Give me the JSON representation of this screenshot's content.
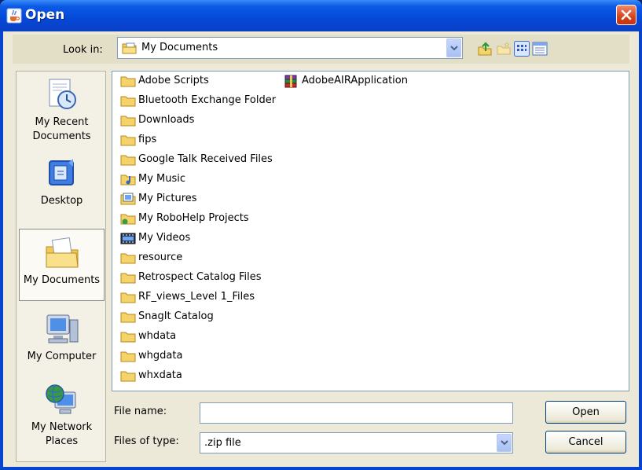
{
  "window": {
    "title": "Open"
  },
  "look_in": {
    "label": "Look in:",
    "value": "My Documents"
  },
  "places": [
    {
      "label_lines": [
        "My Recent",
        "Documents"
      ],
      "icon": "recent-documents-icon"
    },
    {
      "label_lines": [
        "Desktop"
      ],
      "icon": "desktop-icon"
    },
    {
      "label_lines": [
        "My Documents"
      ],
      "icon": "my-documents-icon",
      "selected": true
    },
    {
      "label_lines": [
        "My Computer"
      ],
      "icon": "my-computer-icon"
    },
    {
      "label_lines": [
        "My Network",
        "Places"
      ],
      "icon": "network-places-icon"
    }
  ],
  "files": [
    {
      "name": "Adobe Scripts",
      "icon": "folder-icon"
    },
    {
      "name": "Bluetooth Exchange Folder",
      "icon": "folder-icon"
    },
    {
      "name": "Downloads",
      "icon": "folder-icon"
    },
    {
      "name": "fips",
      "icon": "folder-icon"
    },
    {
      "name": "Google Talk Received Files",
      "icon": "folder-icon"
    },
    {
      "name": "My Music",
      "icon": "music-folder-icon"
    },
    {
      "name": "My Pictures",
      "icon": "pictures-folder-icon"
    },
    {
      "name": "My RoboHelp Projects",
      "icon": "shared-folder-icon"
    },
    {
      "name": "My Videos",
      "icon": "videos-folder-icon"
    },
    {
      "name": "resource",
      "icon": "folder-icon"
    },
    {
      "name": "Retrospect Catalog Files",
      "icon": "folder-icon"
    },
    {
      "name": "RF_views_Level 1_Files",
      "icon": "folder-icon"
    },
    {
      "name": "SnagIt Catalog",
      "icon": "folder-icon"
    },
    {
      "name": "whdata",
      "icon": "folder-icon"
    },
    {
      "name": "whgdata",
      "icon": "folder-icon"
    },
    {
      "name": "whxdata",
      "icon": "folder-icon"
    },
    {
      "name": "AdobeAIRApplication",
      "icon": "archive-icon"
    }
  ],
  "file_name": {
    "label": "File name:",
    "value": ""
  },
  "file_type": {
    "label": "Files of type:",
    "value": ".zip file"
  },
  "buttons": {
    "open": "Open",
    "cancel": "Cancel"
  },
  "colors": {
    "title_bar": "#0548d8",
    "dialog_bg": "#ece9d8",
    "folder": "#f5d36b",
    "close_button": "#d8421b"
  }
}
